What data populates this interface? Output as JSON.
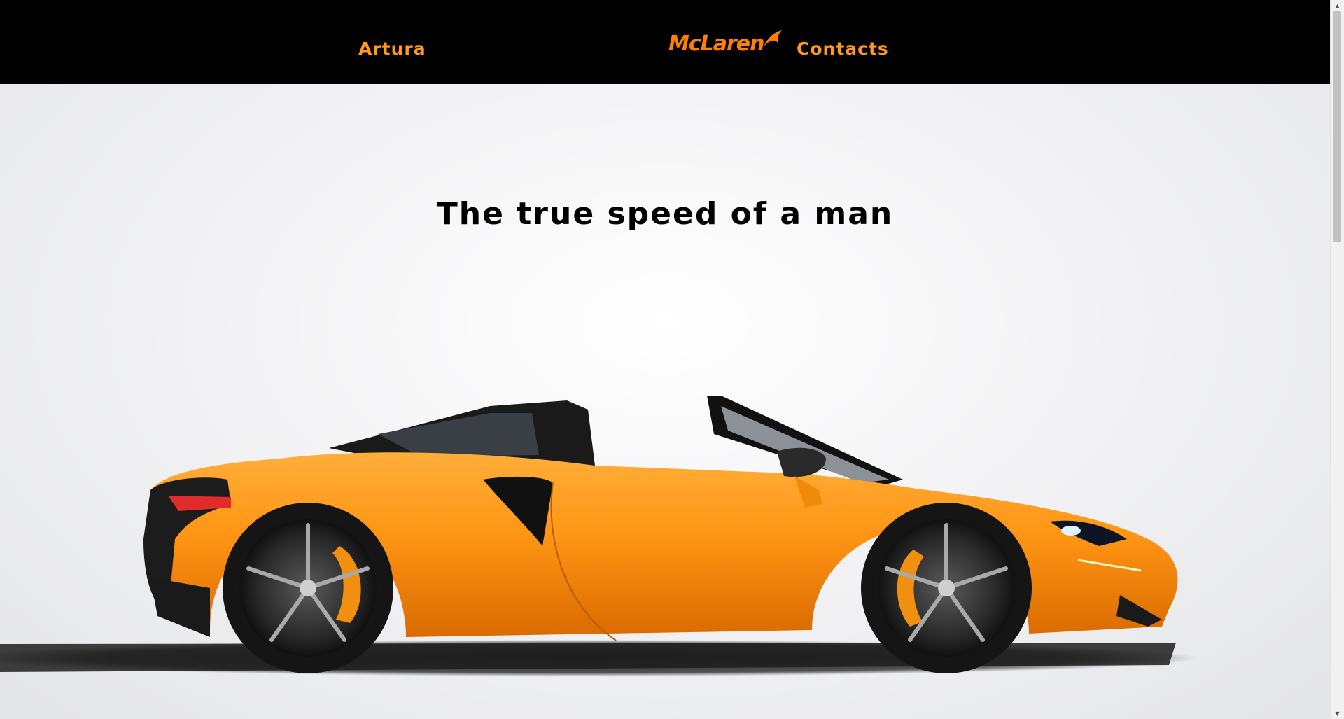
{
  "nav": {
    "left_link": "Artura",
    "logo_text": "McLaren",
    "right_link": "Contacts"
  },
  "hero": {
    "headline": "The true speed of a man",
    "image_icon": "car-image"
  },
  "scrollbar": {
    "up_arrow": "▲",
    "down_arrow": "▼"
  },
  "colors": {
    "nav_background": "#000000",
    "brand_orange": "#ff8000",
    "nav_link": "#ff9a1f",
    "headline": "#000000"
  }
}
